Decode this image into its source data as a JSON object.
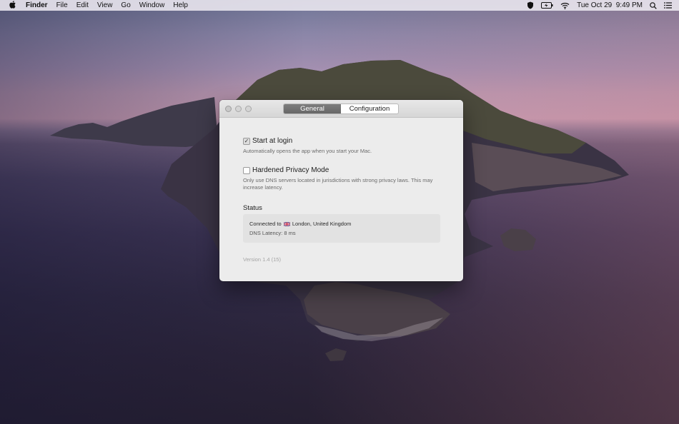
{
  "menubar": {
    "app_name": "Finder",
    "menus": [
      "File",
      "Edit",
      "View",
      "Go",
      "Window",
      "Help"
    ],
    "clock": "Tue Oct 29  9:49 PM",
    "icons": [
      "shield-icon",
      "battery-icon",
      "wifi-icon",
      "search-icon",
      "list-icon"
    ]
  },
  "window": {
    "tabs": [
      {
        "label": "General",
        "active": true
      },
      {
        "label": "Configuration",
        "active": false
      }
    ],
    "options": [
      {
        "label": "Start at login",
        "checked": true,
        "description": "Automatically opens the app when you start your Mac."
      },
      {
        "label": "Hardened Privacy Mode",
        "checked": false,
        "description": "Only use DNS servers located in jurisdictions with strong privacy laws. This may increase latency."
      }
    ],
    "status": {
      "title": "Status",
      "connected_prefix": "Connected to",
      "location": "London, United Kingdom",
      "latency": "DNS Latency: 8 ms"
    },
    "version": "Version 1.4 (15)"
  },
  "colors": {
    "tab_active": "#6f6f6f",
    "window_bg": "#ececec"
  }
}
